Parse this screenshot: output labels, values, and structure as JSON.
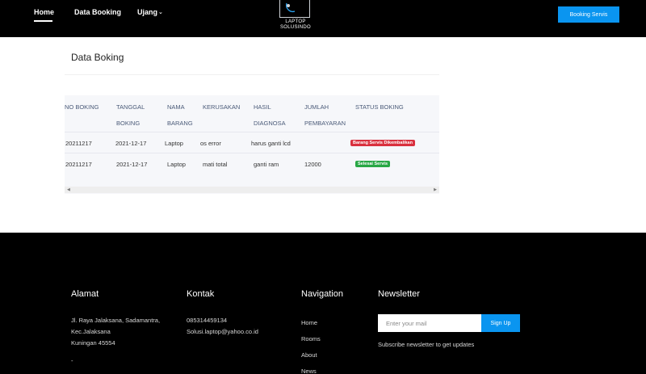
{
  "header": {
    "nav": [
      {
        "label": "Home"
      },
      {
        "label": "Data Booking"
      },
      {
        "label": "Ujang"
      }
    ],
    "logo": {
      "line1": "LAPTOP",
      "line2": "SOLUSINDO"
    },
    "cta_label": "Booking Servis"
  },
  "main": {
    "title": "Data Boking",
    "table": {
      "columns": [
        {
          "line1": "NO BOKING",
          "line2": ""
        },
        {
          "line1": "TANGGAL",
          "line2": "BOKING"
        },
        {
          "line1": "NAMA",
          "line2": "BARANG"
        },
        {
          "line1": "KERUSAKAN",
          "line2": ""
        },
        {
          "line1": "HASIL",
          "line2": "DIAGNOSA"
        },
        {
          "line1": "JUMLAH",
          "line2": "PEMBAYARAN"
        },
        {
          "line1": "STATUS BOKING",
          "line2": ""
        }
      ],
      "rows": [
        {
          "no": "20211217",
          "tanggal": "2021-12-17",
          "nama": "Laptop",
          "kerusakan": "os error",
          "hasil": "harus ganti lcd",
          "jumlah": "",
          "status": "Barang Servis Dikembalikan",
          "status_color": "#d9303e"
        },
        {
          "no": "20211217",
          "tanggal": "2021-12-17",
          "nama": "Laptop",
          "kerusakan": "mati total",
          "hasil": "ganti ram",
          "jumlah": "12000",
          "status": "Selesai Servis",
          "status_color": "#28a745"
        }
      ]
    }
  },
  "footer": {
    "alamat": {
      "heading": "Alamat",
      "line1": "Jl. Raya Jalaksana, Sadamantra,",
      "line2": "Kec.Jalaksana",
      "line3": "Kuningan 45554",
      "line4": "-"
    },
    "kontak": {
      "heading": "Kontak",
      "phone": "085314459134",
      "email": "Solusi.laptop@yahoo.co.id"
    },
    "navigation": {
      "heading": "Navigation",
      "links": [
        "Home",
        "Rooms",
        "About",
        "News"
      ]
    },
    "newsletter": {
      "heading": "Newsletter",
      "placeholder": "Enter your mail",
      "button": "Sign Up",
      "note": "Subscribe newsletter to get updates"
    }
  },
  "colors": {
    "accent": "#0a95f0",
    "danger": "#d9303e",
    "success": "#28a745"
  }
}
